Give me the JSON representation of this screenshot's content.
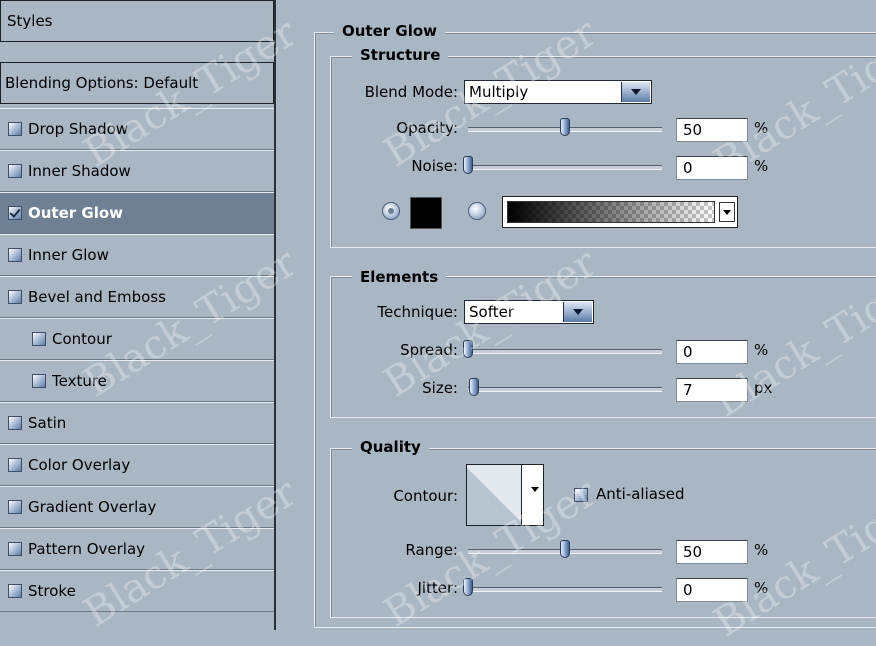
{
  "sidebar": {
    "header": "Styles",
    "blending": "Blending Options: Default",
    "items": [
      {
        "label": "Drop Shadow",
        "checked": false
      },
      {
        "label": "Inner Shadow",
        "checked": false
      },
      {
        "label": "Outer Glow",
        "checked": true,
        "selected": true
      },
      {
        "label": "Inner Glow",
        "checked": false
      },
      {
        "label": "Bevel and Emboss",
        "checked": false
      },
      {
        "label": "Contour",
        "checked": false,
        "indent": true
      },
      {
        "label": "Texture",
        "checked": false,
        "indent": true
      },
      {
        "label": "Satin",
        "checked": false
      },
      {
        "label": "Color Overlay",
        "checked": false
      },
      {
        "label": "Gradient Overlay",
        "checked": false
      },
      {
        "label": "Pattern Overlay",
        "checked": false
      },
      {
        "label": "Stroke",
        "checked": false
      }
    ]
  },
  "panel": {
    "title": "Outer Glow",
    "structure": {
      "title": "Structure",
      "blend_mode_label": "Blend Mode:",
      "blend_mode_value": "Multiply",
      "opacity_label": "Opacity:",
      "opacity_value": "50",
      "opacity_unit": "%",
      "opacity_level": 0.5,
      "noise_label": "Noise:",
      "noise_value": "0",
      "noise_unit": "%",
      "noise_level": 0.0,
      "glow_color": "#000000"
    },
    "elements": {
      "title": "Elements",
      "technique_label": "Technique:",
      "technique_value": "Softer",
      "spread_label": "Spread:",
      "spread_value": "0",
      "spread_unit": "%",
      "spread_level": 0.0,
      "size_label": "Size:",
      "size_value": "7",
      "size_unit": "px",
      "size_level": 0.03
    },
    "quality": {
      "title": "Quality",
      "contour_label": "Contour:",
      "anti_aliased_label": "Anti-aliased",
      "anti_aliased": false,
      "range_label": "Range:",
      "range_value": "50",
      "range_unit": "%",
      "range_level": 0.5,
      "jitter_label": "Jitter:",
      "jitter_value": "0",
      "jitter_unit": "%",
      "jitter_level": 0.0
    }
  },
  "watermark": "Black_Tiger",
  "colors": {
    "panel_bg": "#a9b6c3",
    "selected_row": "#6f8095",
    "accent": "#5c7ca9"
  }
}
